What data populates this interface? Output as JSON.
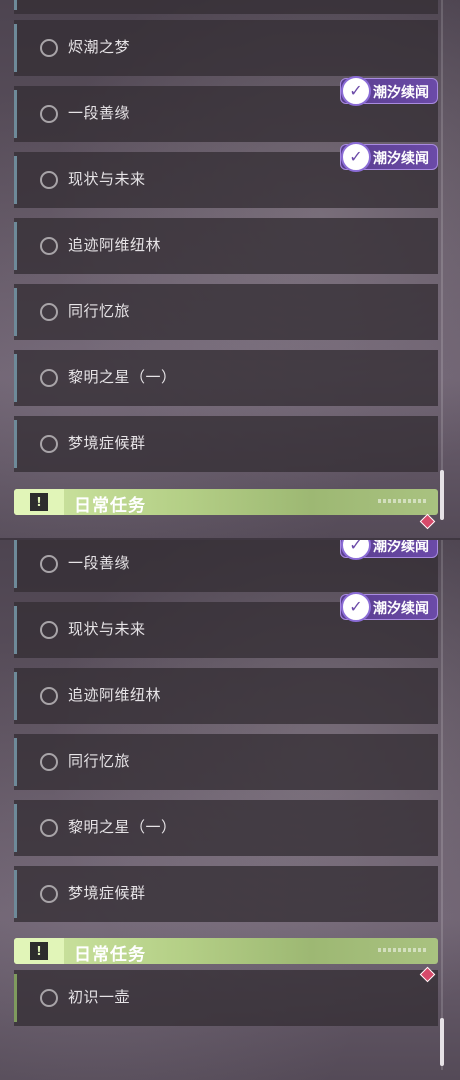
{
  "top_list": {
    "items": [
      {
        "label": "烬潮之梦"
      },
      {
        "label": "一段善缘"
      },
      {
        "label": "现状与未来"
      },
      {
        "label": "追迹阿维纽林"
      },
      {
        "label": "同行忆旅"
      },
      {
        "label": "黎明之星（一）"
      },
      {
        "label": "梦境症候群"
      }
    ],
    "badge_text": "潮汐续闻",
    "section_title": "日常任务"
  },
  "bottom_list": {
    "items": [
      {
        "label": "一段善缘"
      },
      {
        "label": "现状与未来"
      },
      {
        "label": "追迹阿维纽林"
      },
      {
        "label": "同行忆旅"
      },
      {
        "label": "黎明之星（一）"
      },
      {
        "label": "梦境症候群"
      }
    ],
    "badge_text": "潮汐续闻",
    "section_title": "日常任务",
    "daily_items": [
      {
        "label": "初识一壶"
      }
    ]
  },
  "icons": {
    "badge_logo": "tide-logo-icon",
    "section_icon": "alert-icon",
    "status_icon": "empty-circle-icon",
    "notify_icon": "red-diamond-icon"
  },
  "colors": {
    "badge_bg": "#6b4aa8",
    "section_header": "#b4cf86",
    "notify": "#d64a6a"
  }
}
